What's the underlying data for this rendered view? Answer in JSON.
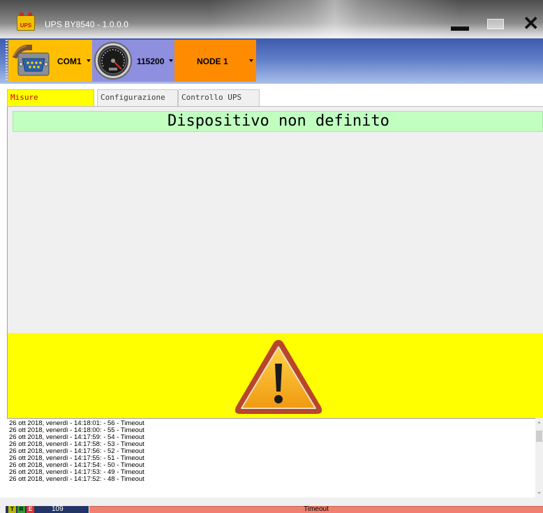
{
  "window": {
    "icon_text": "UPS",
    "title": "UPS BY8540 - 1.0.0.0",
    "icons": {
      "minimize": "minimize-icon",
      "maximize": "maximize-icon",
      "close": "close-icon"
    }
  },
  "toolbar": {
    "com_port": {
      "label": "COM1",
      "icon": "serial-connector-icon"
    },
    "baud_rate": {
      "label": "115200",
      "icon": "speedometer-icon"
    },
    "node": {
      "label": "NODE 1"
    }
  },
  "tabs": [
    {
      "label": "Misure",
      "active": true
    },
    {
      "label": "Configurazione",
      "active": false
    },
    {
      "label": "Controllo UPS",
      "active": false
    }
  ],
  "main": {
    "banner_text": "Dispositivo non definito",
    "alert_icon": "warning-triangle-icon"
  },
  "log": {
    "lines": [
      "26 ott 2018, venerdì - 14:18:01: - 56 - Timeout",
      "26 ott 2018, venerdì - 14:18:00: - 55 - Timeout",
      "26 ott 2018, venerdì - 14:17:59: - 54 - Timeout",
      "26 ott 2018, venerdì - 14:17:58: - 53 - Timeout",
      "26 ott 2018, venerdì - 14:17:56: - 52 - Timeout",
      "26 ott 2018, venerdì - 14:17:55: - 51 - Timeout",
      "26 ott 2018, venerdì - 14:17:54: - 50 - Timeout",
      "26 ott 2018, venerdì - 14:17:53: - 49 - Timeout",
      "26 ott 2018, venerdì - 14:17:52: - 48 - Timeout"
    ]
  },
  "status": {
    "leds": [
      "T",
      "R",
      "E"
    ],
    "count": "109",
    "message": "Timeout"
  },
  "colors": {
    "com_bg": "#ffbf00",
    "baud_bg": "#8f8fe0",
    "node_bg": "#ff8c00",
    "active_tab_bg": "#ffff00",
    "active_tab_text": "#d00000",
    "banner_bg": "#c1ffc1",
    "alert_bg": "#ffff00",
    "status_message_bg": "#f08070"
  }
}
